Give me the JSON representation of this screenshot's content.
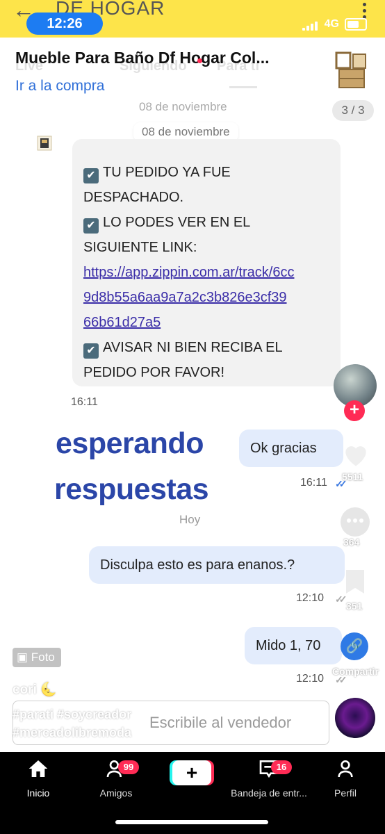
{
  "status_bar": {
    "time": "12:26",
    "network": "4G"
  },
  "store_bar": {
    "back_icon": "back-arrow-icon",
    "store_name": "DE HOGAR"
  },
  "tiktok_tabs": [
    "Live",
    "Siguiendo",
    "Para ti"
  ],
  "header": {
    "product_title": "Mueble Para Baño Df Hogar Col...",
    "purchase_link": "Ir a la compra",
    "image_counter": "3 / 3"
  },
  "chat": {
    "date_divider": "08 de noviembre",
    "received_message": {
      "lines": [
        {
          "check": true,
          "text": "TU PEDIDO YA FUE"
        },
        {
          "check": false,
          "text": "DESPACHADO."
        },
        {
          "check": true,
          "text": "LO PODES VER EN EL"
        },
        {
          "check": false,
          "text": "SIGUIENTE LINK:"
        },
        {
          "check": false,
          "text": "https://app.zippin.com.ar/track/6cc",
          "link": true
        },
        {
          "check": false,
          "text": "9d8b55a6aa9a7a2c3b826e3cf39",
          "link": true
        },
        {
          "check": false,
          "text": "66b61d27a5",
          "link": true
        },
        {
          "check": true,
          "text": "AVISAR NI BIEN RECIBA EL"
        },
        {
          "check": false,
          "text": "PEDIDO POR FAVOR!"
        }
      ],
      "time": "16:11"
    },
    "sent_1": {
      "text": "Ok gracias",
      "time": "16:11"
    },
    "today_divider": "Hoy",
    "sent_2": {
      "text": "Disculpa esto es para enanos.?",
      "time": "12:10"
    },
    "sent_3": {
      "text": "Mido 1, 70",
      "time": "12:10"
    },
    "input_placeholder": "Escribile al vendedor"
  },
  "overlay_text": {
    "line1": "esperando",
    "line2": "respuestas"
  },
  "right_rail": {
    "likes": "5511",
    "comments": "364",
    "saves": "351",
    "share_label": "Compartir"
  },
  "post": {
    "photo_badge": "Foto",
    "username": "cori 🌜",
    "caption_line1": "#parati #soycreador",
    "caption_line2": "#mercadolibremoda"
  },
  "bottom_nav": {
    "home": "Inicio",
    "friends": "Amigos",
    "friends_badge": "99",
    "inbox": "Bandeja de entr...",
    "inbox_badge": "16",
    "profile": "Perfil",
    "create_symbol": "+"
  },
  "colors": {
    "store_yellow": "#fde44a",
    "link_blue": "#2f6fd8",
    "overlay_blue": "#2b46a8",
    "sent_bubble": "#e3ecfc",
    "tiktok_red": "#ff2b55"
  }
}
